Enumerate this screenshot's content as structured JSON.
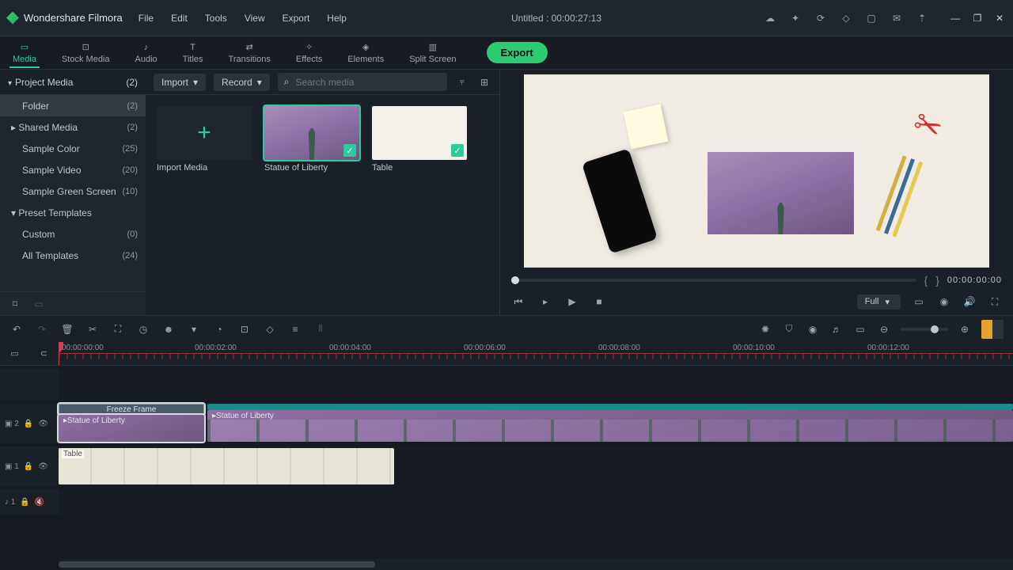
{
  "app": {
    "name": "Wondershare Filmora"
  },
  "menu": {
    "file": "File",
    "edit": "Edit",
    "tools": "Tools",
    "view": "View",
    "export": "Export",
    "help": "Help"
  },
  "title": {
    "center": "Untitled : 00:00:27:13"
  },
  "tabs": {
    "media": "Media",
    "stock": "Stock Media",
    "audio": "Audio",
    "titles": "Titles",
    "transitions": "Transitions",
    "effects": "Effects",
    "elements": "Elements",
    "split": "Split Screen"
  },
  "export_btn": "Export",
  "import_dd": "Import",
  "record_dd": "Record",
  "search_placeholder": "Search media",
  "tree": {
    "project_media": {
      "label": "Project Media",
      "count": "(2)"
    },
    "folder": {
      "label": "Folder",
      "count": "(2)"
    },
    "shared": {
      "label": "Shared Media",
      "count": "(2)"
    },
    "sample_color": {
      "label": "Sample Color",
      "count": "(25)"
    },
    "sample_video": {
      "label": "Sample Video",
      "count": "(20)"
    },
    "green": {
      "label": "Sample Green Screen",
      "count": "(10)"
    },
    "preset": {
      "label": "Preset Templates"
    },
    "custom": {
      "label": "Custom",
      "count": "(0)"
    },
    "all_tpl": {
      "label": "All Templates",
      "count": "(24)"
    }
  },
  "thumbs": {
    "import": "Import Media",
    "statue": "Statue of Liberty",
    "table": "Table"
  },
  "preview": {
    "time": "00:00:00:00",
    "quality": "Full"
  },
  "ruler": {
    "t0": "00:00:00:00",
    "t2": "00:00:02:00",
    "t4": "00:00:04:00",
    "t6": "00:00:06:00",
    "t8": "00:00:08:00",
    "t10": "00:00:10:00",
    "t12": "00:00:12:00"
  },
  "tracks": {
    "v2": "▣ 2",
    "v1": "▣ 1",
    "a1": "♪ 1"
  },
  "clips": {
    "freeze": "Freeze Frame",
    "statue1": "Statue of Liberty",
    "statue2": "Statue of Liberty",
    "table": "Table"
  }
}
